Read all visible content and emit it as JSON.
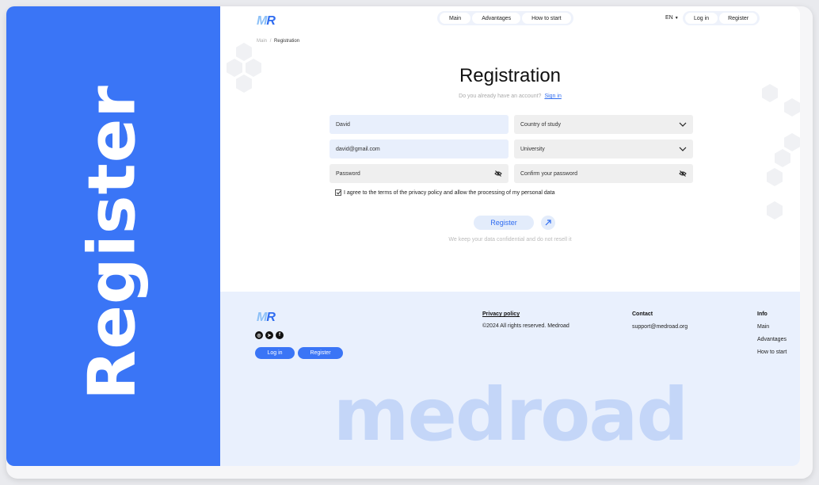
{
  "side_banner": {
    "text": "Register"
  },
  "header": {
    "logo": {
      "m": "M",
      "r": "R"
    },
    "nav": [
      "Main",
      "Advantages",
      "How to start"
    ],
    "lang": "EN",
    "login": "Log in",
    "register": "Register"
  },
  "breadcrumb": {
    "root": "Main",
    "sep": "/",
    "current": "Registration"
  },
  "form": {
    "title": "Registration",
    "subtitle": "Do you already have an account?",
    "signin": "Sign in",
    "name_value": "David",
    "email_value": "david@gmail.com",
    "password_placeholder": "Password",
    "country_placeholder": "Country of study",
    "university_placeholder": "University",
    "confirm_placeholder": "Confirm your password",
    "agree": "I agree to the terms of the privacy policy and allow the processing of my personal data",
    "submit": "Register",
    "note": "We keep your data confidential and do not resell it"
  },
  "footer": {
    "social": [
      "instagram-icon",
      "telegram-icon",
      "facebook-icon"
    ],
    "login": "Log in",
    "register": "Register",
    "privacy_title": "Privacy policy",
    "copyright": "©2024 All rights reserved. Medroad",
    "contact_title": "Contact",
    "contact_email": "support@medroad.org",
    "info_title": "Info",
    "info_links": [
      "Main",
      "Advantages",
      "How to start"
    ],
    "wordmark": "medroad"
  },
  "colors": {
    "accent": "#3a75f6",
    "light": "#e9f0fd",
    "wordmark": "#c4d6f8"
  }
}
